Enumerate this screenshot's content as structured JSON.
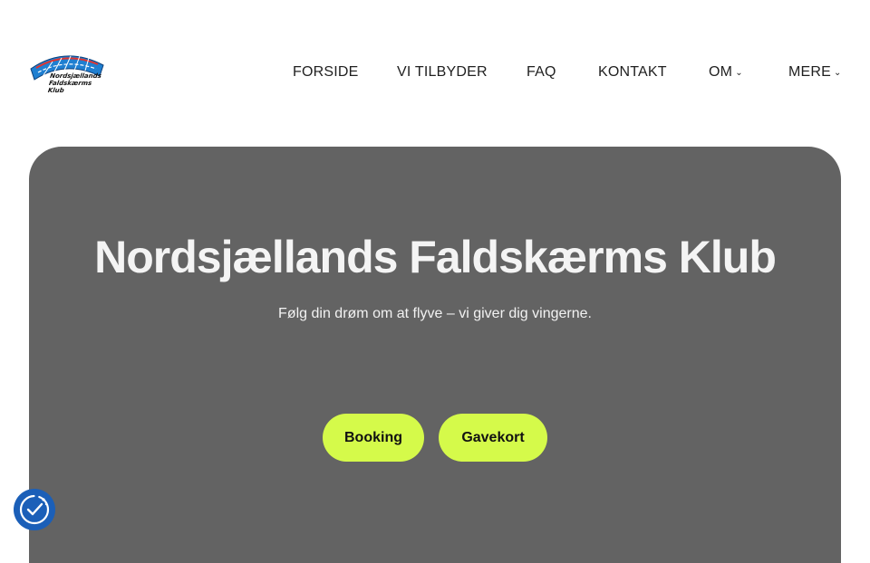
{
  "logo": {
    "lines": [
      "Nordsjællands",
      "Faldskærms",
      "Klub"
    ]
  },
  "nav": {
    "items": [
      {
        "label": "FORSIDE",
        "dropdown": false
      },
      {
        "label": "VI TILBYDER",
        "dropdown": false
      },
      {
        "label": "FAQ",
        "dropdown": false
      },
      {
        "label": "KONTAKT",
        "dropdown": false
      },
      {
        "label": "OM",
        "dropdown": true
      },
      {
        "label": "MERE",
        "dropdown": true
      }
    ],
    "chevron": "⌄"
  },
  "hero": {
    "title": "Nordsjællands Faldskærms Klub",
    "subtitle": "Følg din drøm om at flyve – vi giver dig vingerne.",
    "buttons": {
      "booking": "Booking",
      "gavekort": "Gavekort"
    },
    "background": "#636363"
  },
  "colors": {
    "accent": "#d5fa4a",
    "consent": "#1b5fb8",
    "logo_blue": "#1f7fd1",
    "logo_red": "#e0342f"
  },
  "icons": {
    "consent": "cookie-consent-check-icon",
    "logo": "parachute-canopy-logo"
  }
}
